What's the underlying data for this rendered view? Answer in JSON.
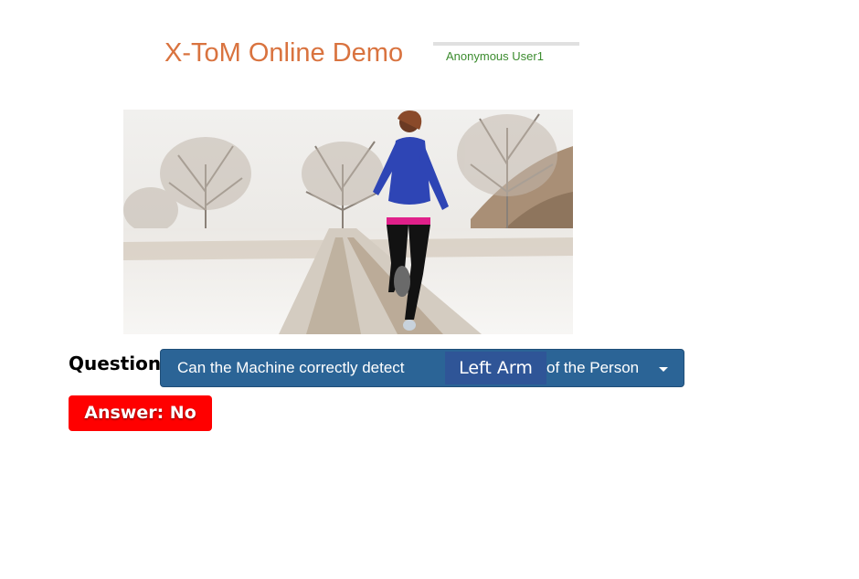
{
  "header": {
    "title": "X-ToM Online Demo",
    "user_label": "Anonymous User1"
  },
  "question": {
    "label": "Question:",
    "prefix": "Can the Machine correctly detect",
    "highlight": "Left Arm",
    "suffix": "of the Person"
  },
  "answer": {
    "text": "Answer: No"
  },
  "colors": {
    "title": "#d9733f",
    "user": "#3c8c2f",
    "question_button": "#2b6496",
    "highlight": "#2f5597",
    "answer": "#ff0000"
  },
  "icons": {
    "dropdown": "caret-down-icon"
  }
}
